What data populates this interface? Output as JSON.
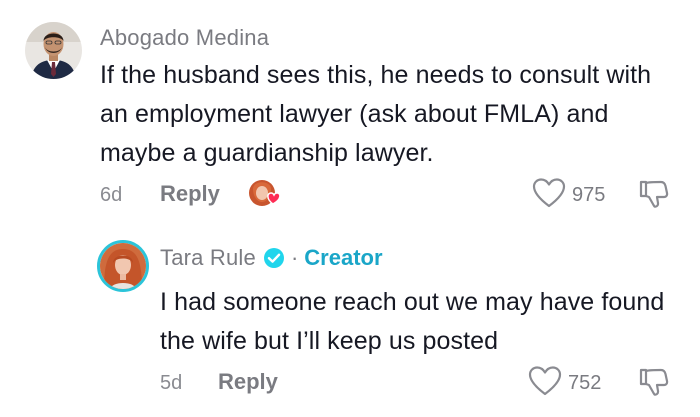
{
  "comments": [
    {
      "username": "Abogado Medina",
      "text": "If the husband sees this, he needs to consult with an employment lawyer (ask about FMLA) and maybe a guardianship lawyer.",
      "age": "6d",
      "reply_label": "Reply",
      "like_count": "975",
      "creator_liked": true
    },
    {
      "username": "Tara Rule",
      "verified": true,
      "creator_tag": "Creator",
      "text": "I had someone reach out we may have found the wife but I’ll keep us posted",
      "age": "5d",
      "reply_label": "Reply",
      "like_count": "752"
    }
  ],
  "separator": "·",
  "colors": {
    "text": "#161823",
    "secondary": "#7a7b81",
    "creator_accent": "#1aa6c8",
    "verified": "#20d5ec",
    "heart_badge": "#fe2c55"
  }
}
